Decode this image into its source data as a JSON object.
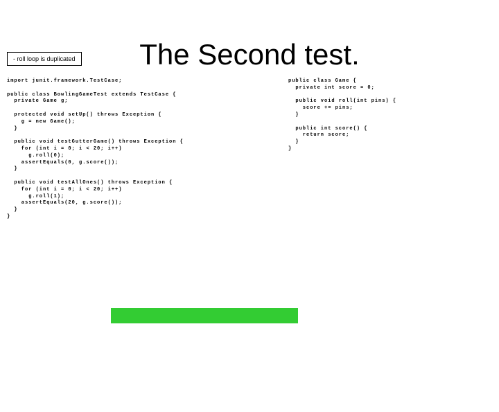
{
  "note": "- roll loop is duplicated",
  "title": "The Second test.",
  "codeLeft": "import junit.framework.TestCase;\n\npublic class BowlingGameTest extends TestCase {\n  private Game g;\n\n  protected void setUp() throws Exception {\n    g = new Game();\n  }\n\n  public void testGutterGame() throws Exception {\n    for (int i = 0; i < 20; i++)\n      g.roll(0);\n    assertEquals(0, g.score());\n  }\n\n  public void testAllOnes() throws Exception {\n    for (int i = 0; i < 20; i++)\n      g.roll(1);\n    assertEquals(20, g.score());\n  }\n}",
  "codeRight": "public class Game {\n  private int score = 0;\n\n  public void roll(int pins) {\n    score += pins;\n  }\n\n  public int score() {\n    return score;\n  }\n}"
}
